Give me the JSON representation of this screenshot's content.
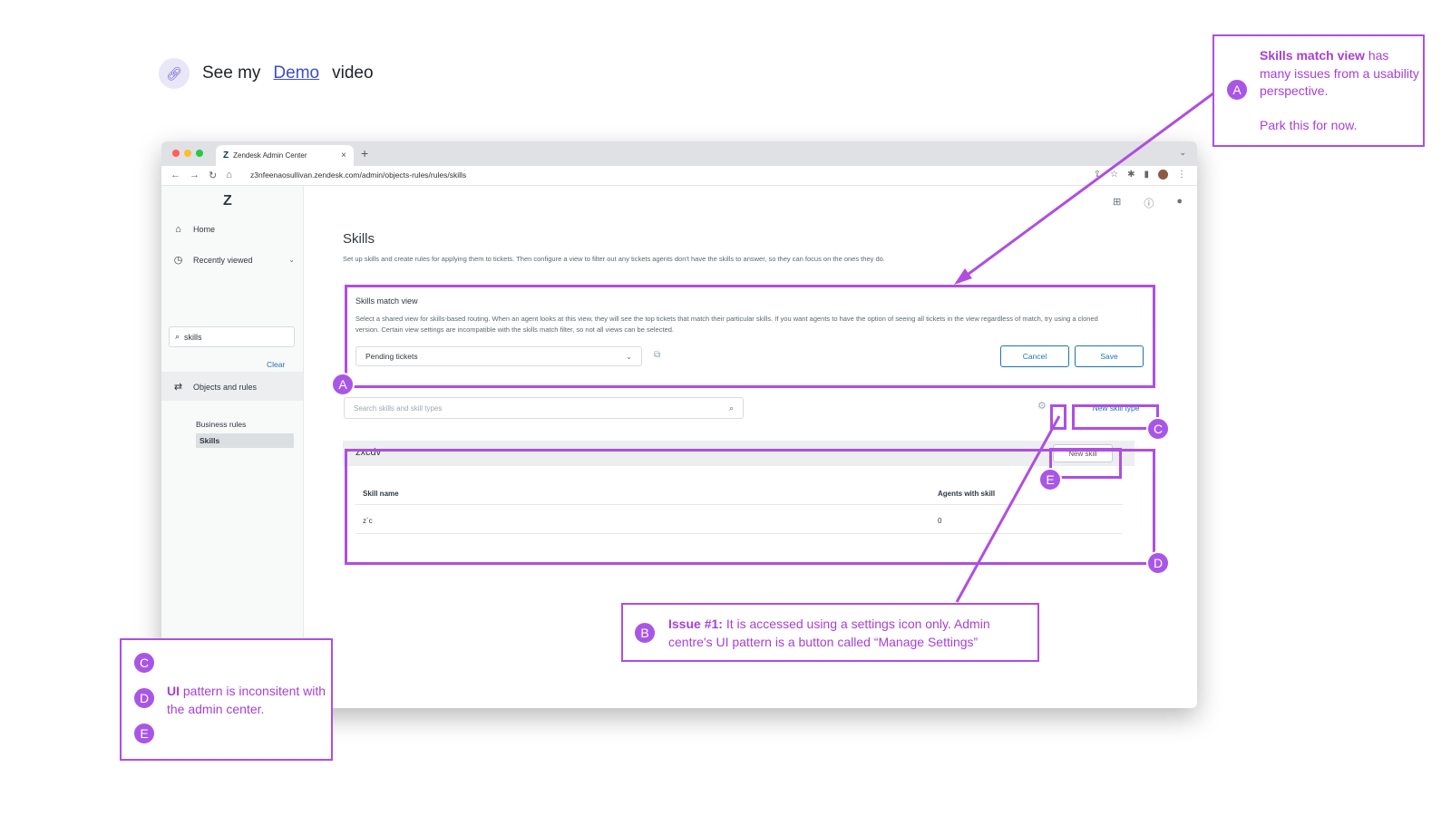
{
  "demo": {
    "prefix": "See my",
    "link": "Demo",
    "suffix": "video"
  },
  "browser": {
    "tab_title": "Zendesk Admin Center",
    "url": "z3nfeenaosullivan.zendesk.com/admin/objects-rules/rules/skills"
  },
  "sidebar": {
    "home": "Home",
    "recently_viewed": "Recently viewed",
    "search_value": "skills",
    "clear": "Clear",
    "objects_rules": "Objects and rules",
    "business_rules": "Business rules",
    "skills": "Skills"
  },
  "main": {
    "title": "Skills",
    "description": "Set up skills and create rules for applying them to tickets. Then configure a view to filter out any tickets agents don't have the skills to answer, so they can focus on the ones they do.",
    "match_view": {
      "title": "Skills match view",
      "description": "Select a shared view for skills-based routing. When an agent looks at this view, they will see the top tickets that match their particular skills. If you want agents to have the option of seeing all tickets in the view regardless of match, try using a cloned version. Certain view settings are incompatible with the skills match filter, so not all views can be selected.",
      "selected": "Pending tickets",
      "cancel": "Cancel",
      "save": "Save"
    },
    "search_placeholder": "Search skills and skill types",
    "new_skill_type": "New skill type",
    "group": {
      "name": "zxcdv",
      "new_skill": "New skill",
      "columns": [
        "Skill name",
        "Agents with skill"
      ],
      "rows": [
        {
          "name": "z`c",
          "agents": "0"
        }
      ]
    }
  },
  "annotations": {
    "a": {
      "badge": "A",
      "bold": "Skills match view",
      "text": " has many issues from a usability perspective.",
      "note": "Park this for now."
    },
    "b": {
      "badge": "B",
      "bold": "Issue #1:",
      "text": " It is accessed using a settings icon only. Admin centre's UI pattern is a button called “Manage Settings”"
    },
    "cde": {
      "badges": [
        "C",
        "D",
        "E"
      ],
      "bold": "UI",
      "text": " pattern is inconsitent with the admin center."
    },
    "badges": {
      "a": "A",
      "c": "C",
      "d": "D",
      "e": "E"
    }
  },
  "colors": {
    "accent": "#a956e6",
    "link": "#1f73b7"
  }
}
